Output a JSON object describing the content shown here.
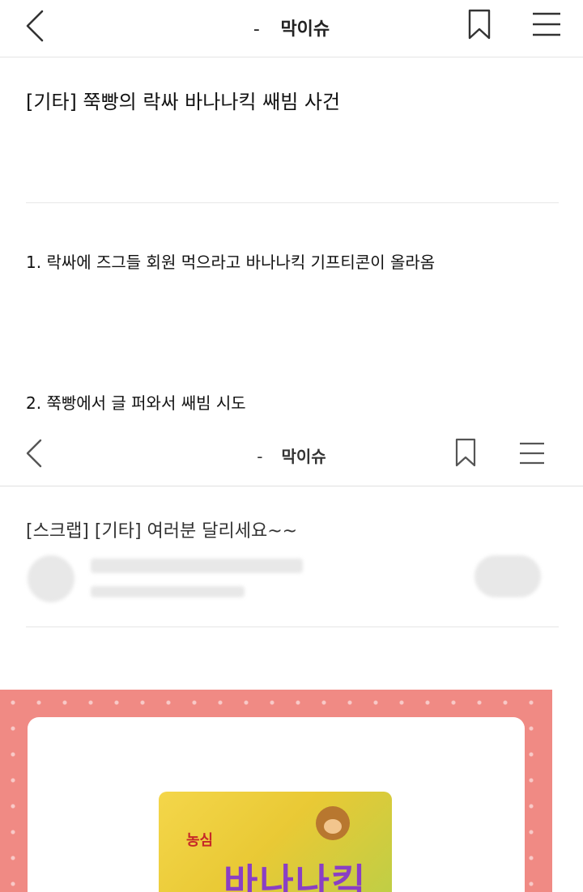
{
  "header": {
    "dash": "-",
    "title": "막이슈"
  },
  "post": {
    "title": "[기타] 쭉빵의 락싸 바나나킥 쌔빔 사건",
    "p1": "1. 락싸에 즈그들 회원 먹으라고 바나나킥 기프티콘이 올라옴",
    "p2": "2. 쭉빵에서 글 퍼와서 쌔빔 시도"
  },
  "embedded": {
    "header": {
      "dash": "-",
      "title": "막이슈"
    },
    "post_title": "[스크랩] [기타] 여러분 달리세요~~",
    "product": {
      "brand_logo": "농심",
      "name": "바나나킥"
    }
  },
  "icons": {
    "back": "chevron-left-icon",
    "bookmark": "bookmark-icon",
    "menu": "hamburger-menu-icon"
  },
  "colors": {
    "promo_bg": "#f08a84",
    "snack_yellow": "#f4d64a",
    "brand_red": "#c62828",
    "brand_purple": "#8a3fc4"
  }
}
